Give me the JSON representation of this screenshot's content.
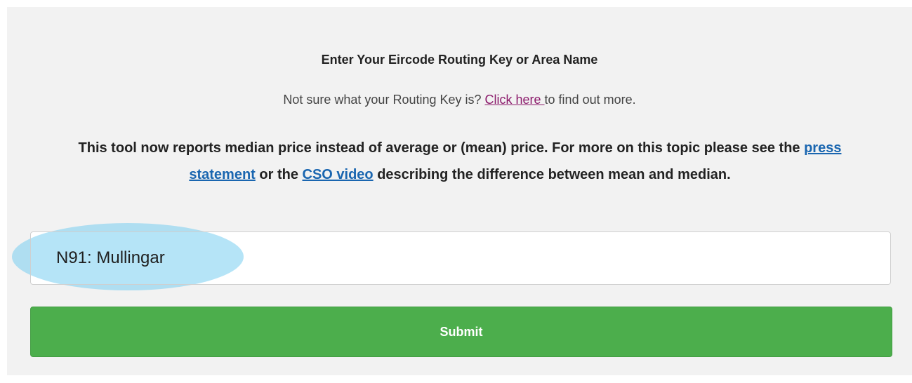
{
  "form": {
    "heading": "Enter Your Eircode Routing Key or Area Name",
    "help_prefix": "Not sure what your Routing Key is? ",
    "help_link": "Click here ",
    "help_suffix": "to find out more.",
    "notice_part1": "This tool now reports median price instead of average or (mean) price. For more on this topic please see the ",
    "notice_link1": "press statement",
    "notice_part2": " or the ",
    "notice_link2": "CSO video",
    "notice_part3": " describing the difference between mean and median.",
    "search_value": "N91: Mullingar",
    "submit_label": "Submit"
  },
  "colors": {
    "panel_bg": "#f2f2f2",
    "submit_green": "#4cae4c",
    "link_purple": "#8b1a6b",
    "link_blue": "#1a66b0",
    "highlight": "#78cdf0"
  }
}
